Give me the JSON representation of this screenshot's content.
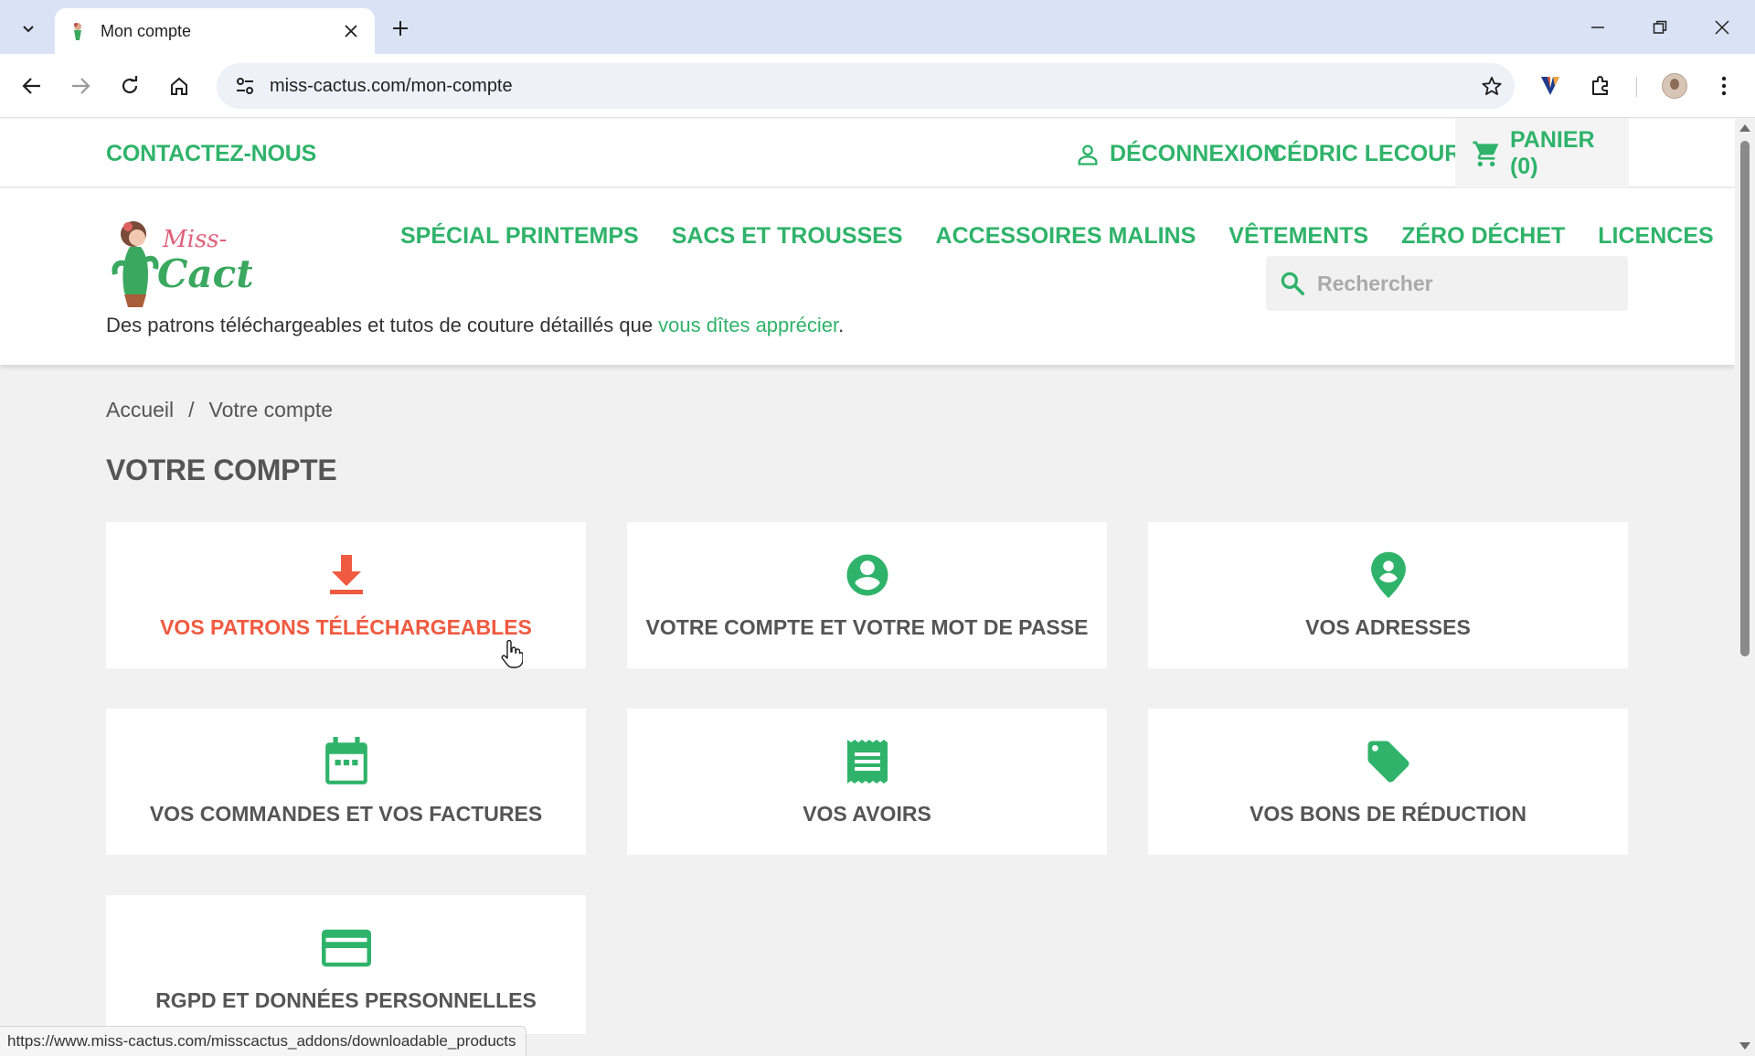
{
  "browser": {
    "tab_title": "Mon compte",
    "url": "miss-cactus.com/mon-compte",
    "status_url": "https://www.miss-cactus.com/misscactus_addons/downloadable_products"
  },
  "topnav": {
    "contact": "CONTACTEZ-NOUS",
    "logout": "DÉCONNEXION",
    "username": "CÉDRIC LECOURT",
    "cart": "PANIER (0)"
  },
  "header": {
    "logo_text": "Miss-Cactus",
    "menu": [
      "SPÉCIAL PRINTEMPS",
      "SACS ET TROUSSES",
      "ACCESSOIRES MALINS",
      "VÊTEMENTS",
      "ZÉRO DÉCHET",
      "LICENCES"
    ],
    "search_placeholder": "Rechercher",
    "tagline_pre": "Des patrons téléchargeables et tutos de couture détaillés que ",
    "tagline_link": "vous dîtes apprécier",
    "tagline_post": "."
  },
  "breadcrumb": {
    "home": "Accueil",
    "separator": "/",
    "current": "Votre compte"
  },
  "page_title": "VOTRE COMPTE",
  "cards": [
    {
      "label": "VOS PATRONS TÉLÉCHARGEABLES",
      "icon": "download-icon",
      "active": true
    },
    {
      "label": "VOTRE COMPTE ET VOTRE MOT DE PASSE",
      "icon": "account-circle-icon"
    },
    {
      "label": "VOS ADRESSES",
      "icon": "location-pin-icon"
    },
    {
      "label": "VOS COMMANDES ET VOS FACTURES",
      "icon": "calendar-icon"
    },
    {
      "label": "VOS AVOIRS",
      "icon": "receipt-icon"
    },
    {
      "label": "VOS BONS DE RÉDUCTION",
      "icon": "tag-icon"
    },
    {
      "label": "RGPD ET DONNÉES PERSONNELLES",
      "icon": "credit-card-icon"
    }
  ],
  "colors": {
    "brand_green": "#2fb36a",
    "active_orange": "#f05a40",
    "text_grey": "#555555"
  }
}
